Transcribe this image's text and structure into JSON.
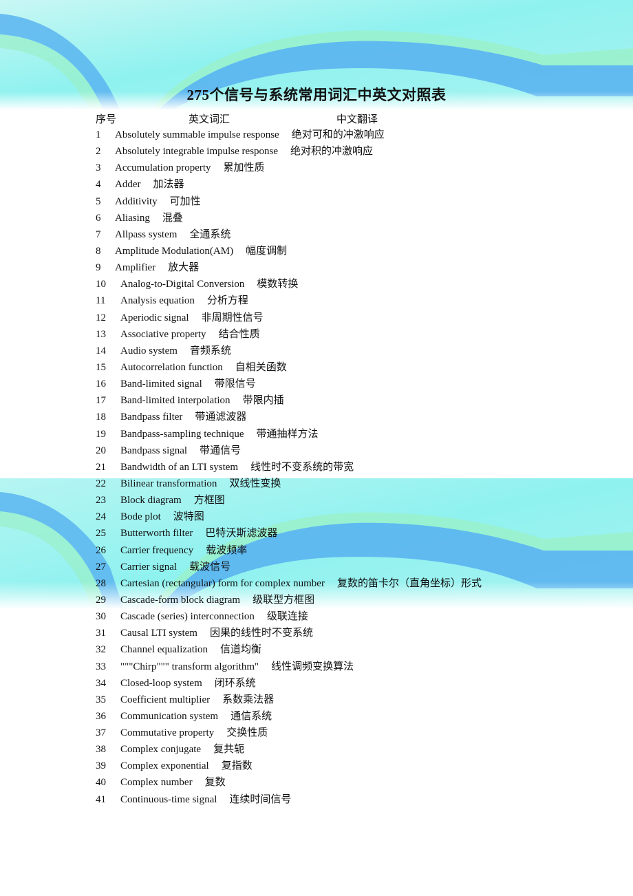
{
  "document": {
    "title": "275个信号与系统常用词汇中英文对照表",
    "columns": {
      "index": "序号",
      "english": "英文词汇",
      "chinese": "中文翻译"
    },
    "colors": {
      "banner_light": "#8ff2ef",
      "banner_blue": "#5ab4f0",
      "banner_green": "#9af0c8"
    },
    "entries": [
      {
        "n": "1",
        "en": "Absolutely summable impulse response",
        "zh": "绝对可和的冲激响应"
      },
      {
        "n": "2",
        "en": "Absolutely integrable impulse response",
        "zh": "绝对积的冲激响应"
      },
      {
        "n": "3",
        "en": "Accumulation property",
        "zh": "累加性质"
      },
      {
        "n": "4",
        "en": "Adder",
        "zh": "加法器"
      },
      {
        "n": "5",
        "en": "Additivity",
        "zh": "可加性"
      },
      {
        "n": "6",
        "en": "Aliasing",
        "zh": "混叠"
      },
      {
        "n": "7",
        "en": "Allpass system",
        "zh": "全通系统"
      },
      {
        "n": "8",
        "en": "Amplitude Modulation(AM)",
        "zh": "幅度调制"
      },
      {
        "n": "9",
        "en": "Amplifier",
        "zh": "放大器"
      },
      {
        "n": "10",
        "en": "Analog-to-Digital Conversion",
        "zh": "模数转换"
      },
      {
        "n": "11",
        "en": "Analysis equation",
        "zh": "分析方程"
      },
      {
        "n": "12",
        "en": "Aperiodic signal",
        "zh": "非周期性信号"
      },
      {
        "n": "13",
        "en": "Associative property",
        "zh": "结合性质"
      },
      {
        "n": "14",
        "en": "Audio system",
        "zh": "音频系统"
      },
      {
        "n": "15",
        "en": "Autocorrelation function",
        "zh": "自相关函数"
      },
      {
        "n": "16",
        "en": "Band-limited signal",
        "zh": "带限信号"
      },
      {
        "n": "17",
        "en": "Band-limited interpolation",
        "zh": "带限内插"
      },
      {
        "n": "18",
        "en": "Bandpass filter",
        "zh": "带通滤波器"
      },
      {
        "n": "19",
        "en": "Bandpass-sampling technique",
        "zh": "带通抽样方法"
      },
      {
        "n": "20",
        "en": "Bandpass signal",
        "zh": "带通信号"
      },
      {
        "n": "21",
        "en": "Bandwidth of an LTI system",
        "zh": "线性时不变系统的带宽"
      },
      {
        "n": "22",
        "en": "Bilinear transformation",
        "zh": "双线性变换"
      },
      {
        "n": "23",
        "en": "Block diagram",
        "zh": "方框图"
      },
      {
        "n": "24",
        "en": "Bode plot",
        "zh": "波特图"
      },
      {
        "n": "25",
        "en": "Butterworth filter",
        "zh": "巴特沃斯滤波器"
      },
      {
        "n": "26",
        "en": "Carrier frequency",
        "zh": "载波频率"
      },
      {
        "n": "27",
        "en": "Carrier signal",
        "zh": "载波信号"
      },
      {
        "n": "28",
        "en": "Cartesian (rectangular) form for complex number",
        "zh": "复数的笛卡尔（直角坐标）形式"
      },
      {
        "n": "29",
        "en": "Cascade-form block diagram",
        "zh": "级联型方框图"
      },
      {
        "n": "30",
        "en": "Cascade (series) interconnection",
        "zh": "级联连接"
      },
      {
        "n": "31",
        "en": "Causal LTI system",
        "zh": "因果的线性时不变系统"
      },
      {
        "n": "32",
        "en": "Channel equalization",
        "zh": "信道均衡"
      },
      {
        "n": "33",
        "en": "\"\"\"Chirp\"\"\" transform algorithm\"",
        "zh": "线性调频变换算法"
      },
      {
        "n": "34",
        "en": "Closed-loop system",
        "zh": "闭环系统"
      },
      {
        "n": "35",
        "en": "Coefficient multiplier",
        "zh": "系数乘法器"
      },
      {
        "n": "36",
        "en": "Communication system",
        "zh": "通信系统"
      },
      {
        "n": "37",
        "en": "Commutative property",
        "zh": "交换性质"
      },
      {
        "n": "38",
        "en": "Complex conjugate",
        "zh": "复共轭"
      },
      {
        "n": "39",
        "en": "Complex exponential",
        "zh": "复指数"
      },
      {
        "n": "40",
        "en": "Complex number",
        "zh": "复数"
      },
      {
        "n": "41",
        "en": "Continuous-time signal",
        "zh": "连续时间信号"
      }
    ]
  }
}
